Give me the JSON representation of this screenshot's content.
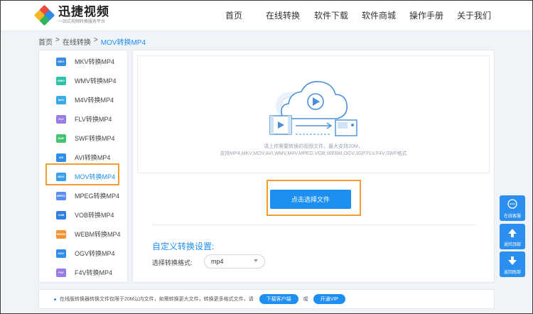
{
  "header": {
    "logo_name": "迅捷视频",
    "logo_sub": "一站式视频转换服务平台",
    "nav": [
      "首页",
      "在线转换",
      "软件下载",
      "软件商城",
      "操作手册",
      "关于我们"
    ]
  },
  "breadcrumb": {
    "home": "首页",
    "sep": ">",
    "section": "在线转换",
    "current": "MOV转换MP4"
  },
  "sidebar": {
    "items": [
      {
        "badge": "MKV",
        "label": "MKV转换MP4",
        "color": "#3a8de0"
      },
      {
        "badge": "WMV",
        "label": "WMV转换MP4",
        "color": "#31c0a8"
      },
      {
        "badge": "M4V",
        "label": "M4V转换MP4",
        "color": "#3aa9e8"
      },
      {
        "badge": "FLV",
        "label": "FLV转换MP4",
        "color": "#9b7be6"
      },
      {
        "badge": "SWF",
        "label": "SWF转换MP4",
        "color": "#43c36f"
      },
      {
        "badge": "AVI",
        "label": "AVI转换MP4",
        "color": "#2f8fe8"
      },
      {
        "badge": "MOV",
        "label": "MOV转换MP4",
        "color": "#3aa0f0"
      },
      {
        "badge": "MPEG",
        "label": "MPEG转换MP4",
        "color": "#5a8ff0"
      },
      {
        "badge": "VOB",
        "label": "VOB转换MP4",
        "color": "#2f7fe0"
      },
      {
        "badge": "WEBM",
        "label": "WEBM转换MP4",
        "color": "#f39233"
      },
      {
        "badge": "OGV",
        "label": "OGV转换MP4",
        "color": "#2f8fe8"
      },
      {
        "badge": "F4V",
        "label": "F4V转换MP4",
        "color": "#9b7be6"
      }
    ],
    "active_index": 6
  },
  "upload": {
    "hint_line1": "请上传需要转换的视频文件，最大支持20M，",
    "hint_line2": "支持MP4,MKV,MOV,AVI,WMV,M4V,MPEG,VOB,WEBM,OGV,3GP,FLV,F4V,SWF格式",
    "button_label": "点击选择文件"
  },
  "settings": {
    "title": "自定义转换设置:",
    "format_label": "选择转换格式:",
    "format_value": "mp4"
  },
  "notice": {
    "text": "在线版转换器转换文件仅限于20M以内文件，如需转换更大文件，转换更多格式文件，请",
    "download_label": "下载客户端",
    "or_label": "或",
    "vip_label": "开通VIP"
  },
  "float_panel": {
    "service_label": "在线客服",
    "top_label": "返回顶部",
    "bottom_label": "返回底部"
  },
  "colors": {
    "accent": "#1e8ff2",
    "highlight": "#f39c33"
  }
}
